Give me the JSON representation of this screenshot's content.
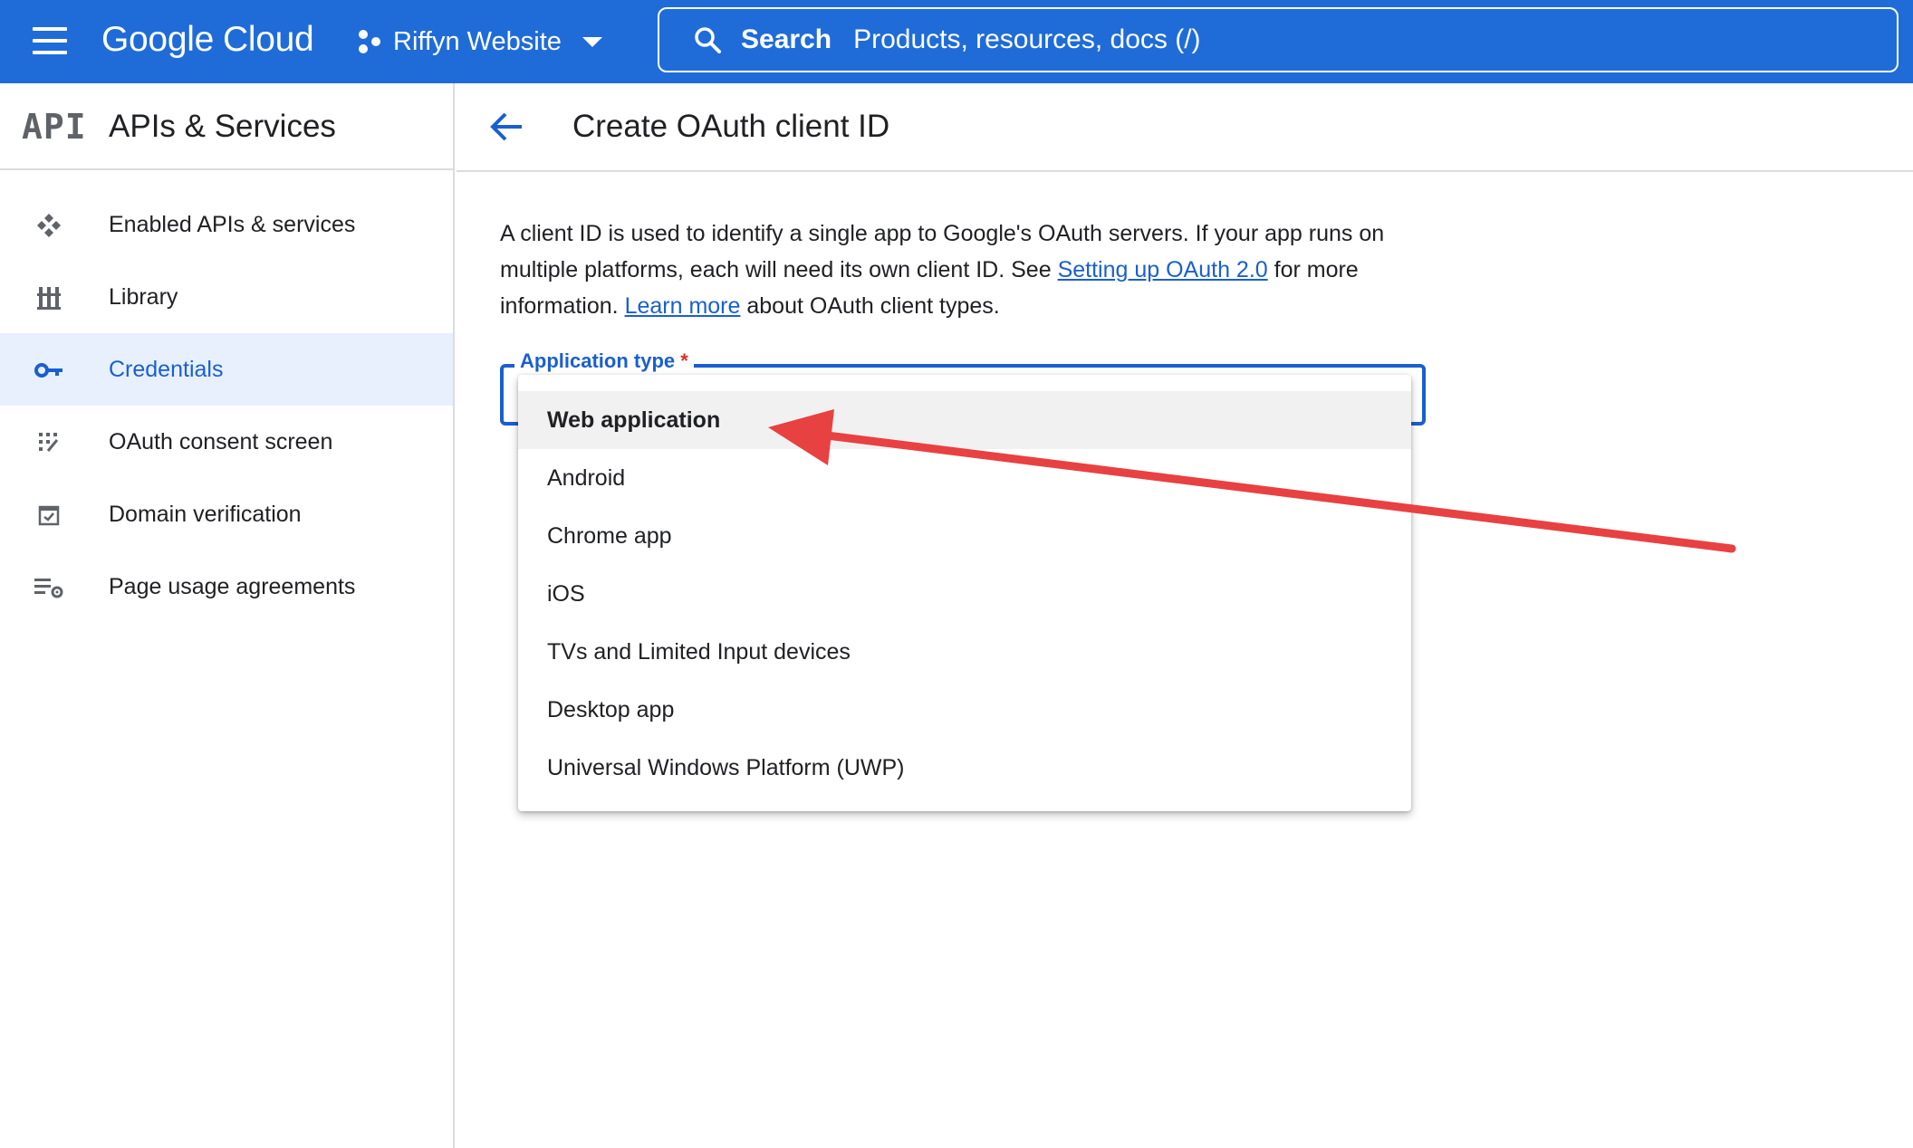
{
  "topbar": {
    "brand_google": "Google",
    "brand_cloud": "Cloud",
    "project_name": "Riffyn Website",
    "search_label": "Search",
    "search_placeholder": "Products, resources, docs (/)"
  },
  "colors": {
    "topbar": "#1f6cd9",
    "accent": "#1a5fd0",
    "active_nav_bg": "#e8f0fe",
    "required": "#d93025",
    "annotation_arrow": "#e84142"
  },
  "sidebar": {
    "logo_text": "API",
    "title": "APIs & Services",
    "items": [
      {
        "label": "Enabled APIs & services",
        "icon": "enabled-apis-icon"
      },
      {
        "label": "Library",
        "icon": "library-icon"
      },
      {
        "label": "Credentials",
        "icon": "key-icon",
        "active": true
      },
      {
        "label": "OAuth consent screen",
        "icon": "oauth-consent-icon"
      },
      {
        "label": "Domain verification",
        "icon": "domain-verification-icon"
      },
      {
        "label": "Page usage agreements",
        "icon": "page-usage-icon"
      }
    ]
  },
  "page": {
    "title": "Create OAuth client ID",
    "intro_1": "A client ID is used to identify a single app to Google's OAuth servers. If your app runs on multiple platforms, each will need its own client ID. See ",
    "intro_link_1": "Setting up OAuth 2.0",
    "intro_2": " for more information. ",
    "intro_link_2": "Learn more",
    "intro_3": " about OAuth client types.",
    "field_label": "Application type",
    "field_required_mark": "*"
  },
  "dropdown": {
    "options": [
      "Web application",
      "Android",
      "Chrome app",
      "iOS",
      "TVs and Limited Input devices",
      "Desktop app",
      "Universal Windows Platform (UWP)"
    ],
    "selected_index": 0
  }
}
